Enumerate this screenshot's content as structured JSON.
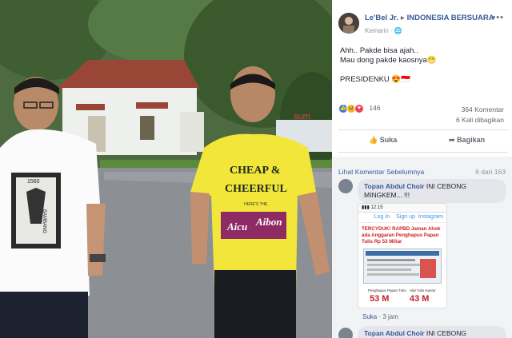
{
  "photo": {
    "shirt_right": {
      "line1": "CHEAP &",
      "line2": "CHEERFUL",
      "line3": "HERE'S THE",
      "band1": "Aicu",
      "band2": "Aibon"
    },
    "shirt_left": {
      "year": "1560",
      "side": "BAMBANG"
    },
    "sign": "sum"
  },
  "post": {
    "author": "Le'Bel Jr.",
    "group": "INDONESIA BERSUARA",
    "time": "Kemarin",
    "more": "•••",
    "text_line1": "Ahh.. Pakde bisa ajah..",
    "text_line2": "Mau dong pakde kaosnya😁",
    "text_line3": "PRESIDENKU 😍🇮🇩"
  },
  "stats": {
    "reactions": "146",
    "comments": "364 Komentar",
    "shares": "6 Kali dibagikan"
  },
  "actions": {
    "like": "Suka",
    "share": "Bagikan"
  },
  "comments": {
    "prev_label": "Lihat Komentar Sebelumnya",
    "count": "6 dari 163",
    "c1_author": "Topan Abdul Choir",
    "c1_text": "INI CEBONG MINGKEM... !!!",
    "c1_like": "Suka",
    "c1_time": "3 jam",
    "c2_author": "Topan Abdul Choir",
    "c2_text": "INI CEBONG"
  },
  "attachment": {
    "app": "Instagram",
    "login": "Log In",
    "signup": "Sign up",
    "headline": "TERCYDUK! RAPBD Jaman Ahok ada Anggaran Penghapus Papan Tulis Rp 53 Miliar",
    "label1": "Penghapus Papan Tulis",
    "label2": "Alat Tulis Kantor",
    "value1": "53 M",
    "value2": "43 M"
  }
}
